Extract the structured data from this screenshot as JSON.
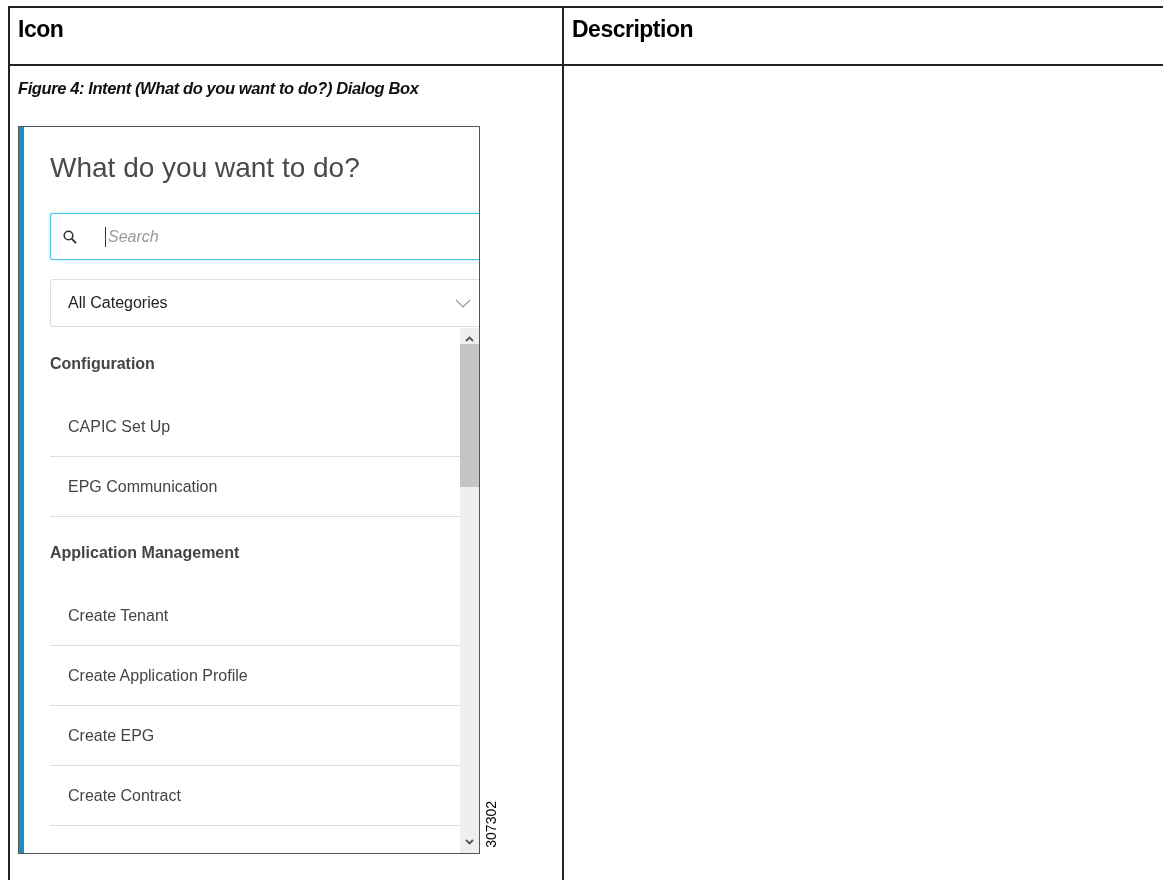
{
  "table": {
    "columns": [
      "Icon",
      "Description"
    ],
    "rows": [
      {
        "figure_caption": "Figure 4: Intent (What do you want to do?) Dialog Box",
        "dialog": {
          "title": "What do you want to do?",
          "search": {
            "placeholder": "Search"
          },
          "category_dropdown": {
            "value": "All Categories"
          },
          "sections": [
            {
              "heading": "Configuration",
              "items": [
                "CAPIC Set Up",
                "EPG Communication"
              ]
            },
            {
              "heading": "Application Management",
              "items": [
                "Create Tenant",
                "Create Application Profile",
                "Create EPG",
                "Create Contract"
              ]
            }
          ]
        },
        "figure_number": "307302"
      }
    ]
  }
}
